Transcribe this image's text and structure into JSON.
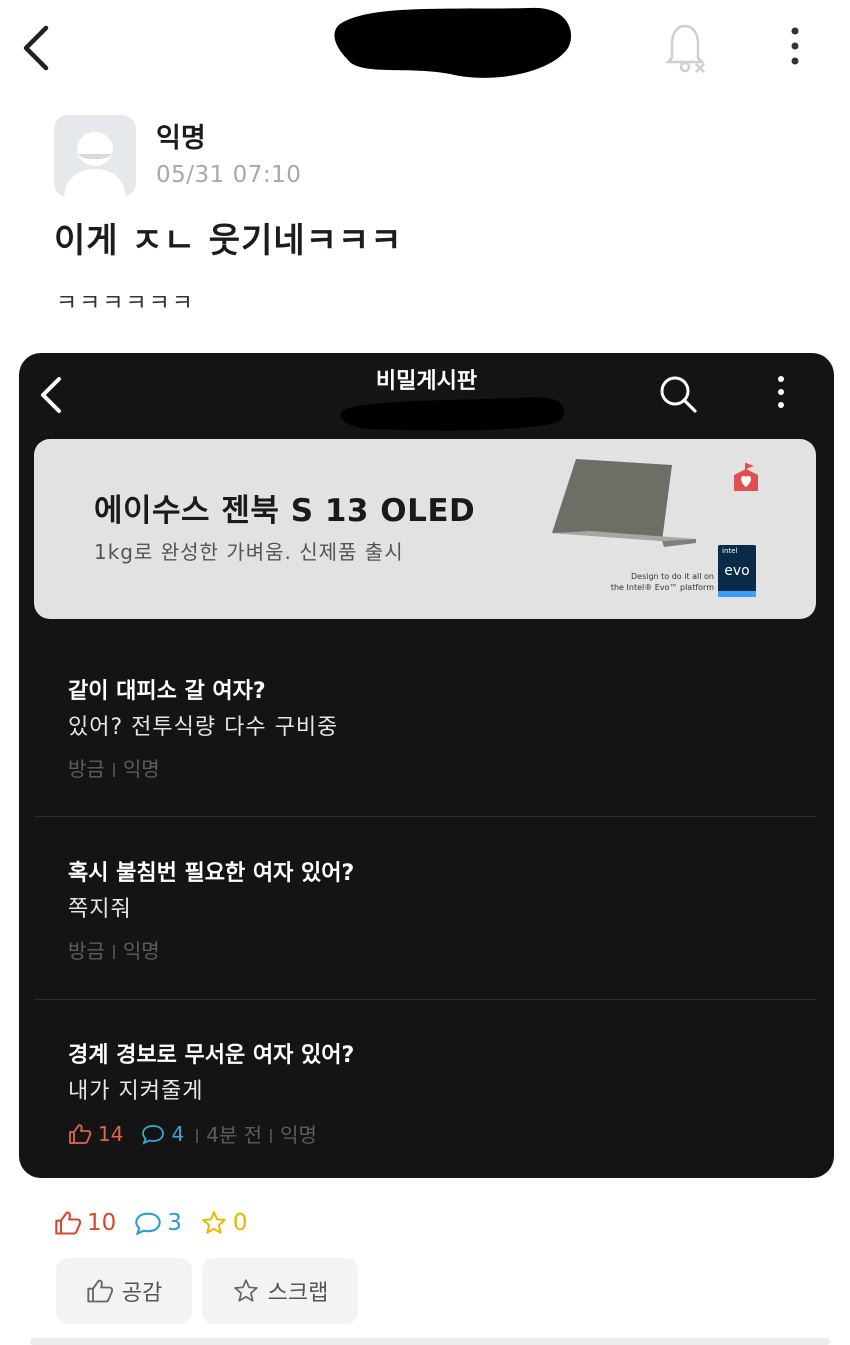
{
  "header": {
    "back_icon": "chevron-left-icon",
    "notification_icon": "bell-off-icon",
    "more_icon": "more-vertical-icon"
  },
  "post": {
    "author": "익명",
    "datetime": "05/31 07:10",
    "title": "이게 ㅈㄴ 웃기네ㅋㅋㅋ",
    "body": "ㅋㅋㅋㅋㅋㅋ"
  },
  "embedded": {
    "board_title": "비밀게시판",
    "ad": {
      "title": "에이수스 젠북 S 13 OLED",
      "subtitle": "1kg로 완성한 가벼움. 신제품 출시",
      "tagline_1": "Design to do it all on",
      "tagline_2": "the Intel® Evo™ platform",
      "badge_top": "intel",
      "badge": "evo"
    },
    "items": [
      {
        "title": "같이 대피소 갈 여자?",
        "body": "있어? 전투식량 다수 구비중",
        "time": "방금",
        "author": "익명"
      },
      {
        "title": "혹시 불침번 필요한 여자 있어?",
        "body": "쪽지줘",
        "time": "방금",
        "author": "익명"
      },
      {
        "title": "경계 경보로 무서운 여자 있어?",
        "body": "내가 지켜줄게",
        "likes": "14",
        "comments": "4",
        "time": "4분 전",
        "author": "익명"
      }
    ]
  },
  "stats": {
    "likes": "10",
    "comments": "3",
    "scraps": "0"
  },
  "actions": {
    "empathy_label": "공감",
    "scrap_label": "스크랩"
  },
  "colors": {
    "like": "#d34a2c",
    "comment": "#2b9bd0",
    "scrap": "#e6b800",
    "embedded_bg": "#141414"
  }
}
